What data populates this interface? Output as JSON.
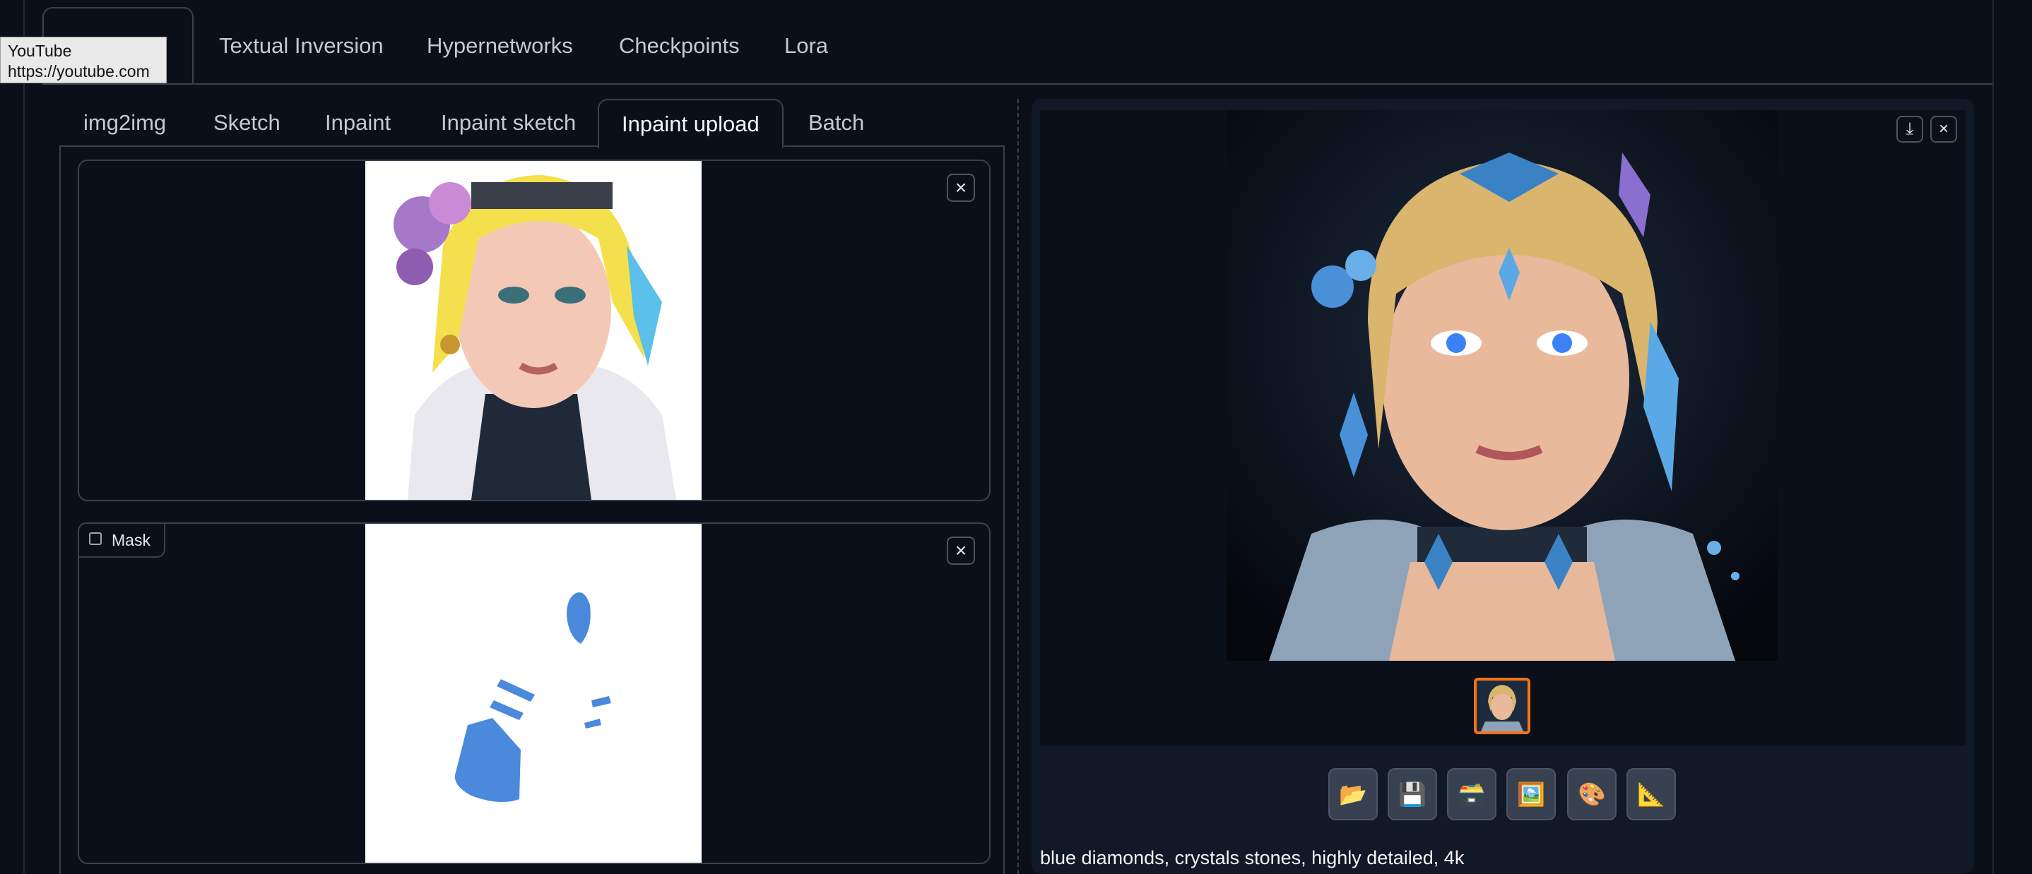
{
  "top_tabs": [
    {
      "label": "img2img",
      "active": true
    },
    {
      "label": "Textual Inversion"
    },
    {
      "label": "Hypernetworks"
    },
    {
      "label": "Checkpoints"
    },
    {
      "label": "Lora"
    }
  ],
  "tooltip": {
    "title": "YouTube",
    "url": "https://youtube.com"
  },
  "sub_tabs": [
    {
      "label": "img2img"
    },
    {
      "label": "Sketch"
    },
    {
      "label": "Inpaint"
    },
    {
      "label": "Inpaint sketch"
    },
    {
      "label": "Inpaint upload",
      "active": true
    },
    {
      "label": "Batch"
    }
  ],
  "mask": {
    "label": "Mask"
  },
  "icons": {
    "close": "×",
    "download": "⤓",
    "buttons": [
      "📂",
      "💾",
      "🗃️",
      "🖼️",
      "🎨",
      "📐"
    ]
  },
  "caption": "blue diamonds, crystals stones, highly detailed, 4k",
  "colors": {
    "accent": "#f97316",
    "mask_blue": "#4a89dc",
    "bg": "#0b0f19"
  }
}
